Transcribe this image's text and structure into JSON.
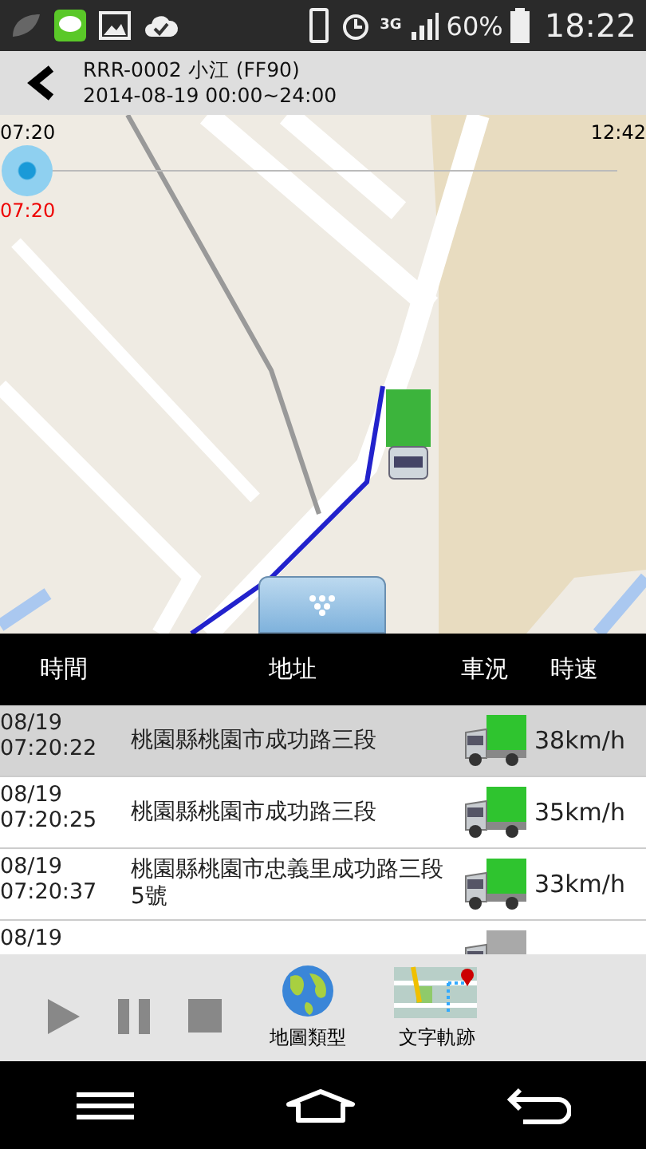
{
  "status_bar": {
    "network": "3G",
    "battery": "60%",
    "time": "18:22"
  },
  "header": {
    "title": "RRR-0002 小江 (FF90)",
    "subtitle": "2014-08-19 00:00~24:00"
  },
  "timeline": {
    "start": "07:20",
    "end": "12:42",
    "current": "07:20",
    "level": 0
  },
  "table": {
    "columns": [
      "時間",
      "地址",
      "車況",
      "時速"
    ],
    "rows": [
      {
        "date": "08/19",
        "time": "07:20:22",
        "address": "桃園縣桃園市成功路三段",
        "kind": "moving",
        "speed": "38km/h",
        "selected": true
      },
      {
        "date": "08/19",
        "time": "07:20:25",
        "address": "桃園縣桃園市成功路三段",
        "kind": "moving",
        "speed": "35km/h",
        "selected": false
      },
      {
        "date": "08/19",
        "time": "07:20:37",
        "address": "桃園縣桃園市忠義里成功路三段5號",
        "kind": "moving",
        "speed": "33km/h",
        "selected": false
      },
      {
        "date": "08/19",
        "kind": "stopped",
        "selected": false
      }
    ]
  },
  "toolbar": [
    {
      "kind": "play"
    },
    {
      "kind": "pause"
    },
    {
      "kind": "stop"
    },
    {
      "kind": "globe",
      "label": "地圖類型"
    },
    {
      "kind": "map",
      "label": "文字軌跡"
    }
  ]
}
